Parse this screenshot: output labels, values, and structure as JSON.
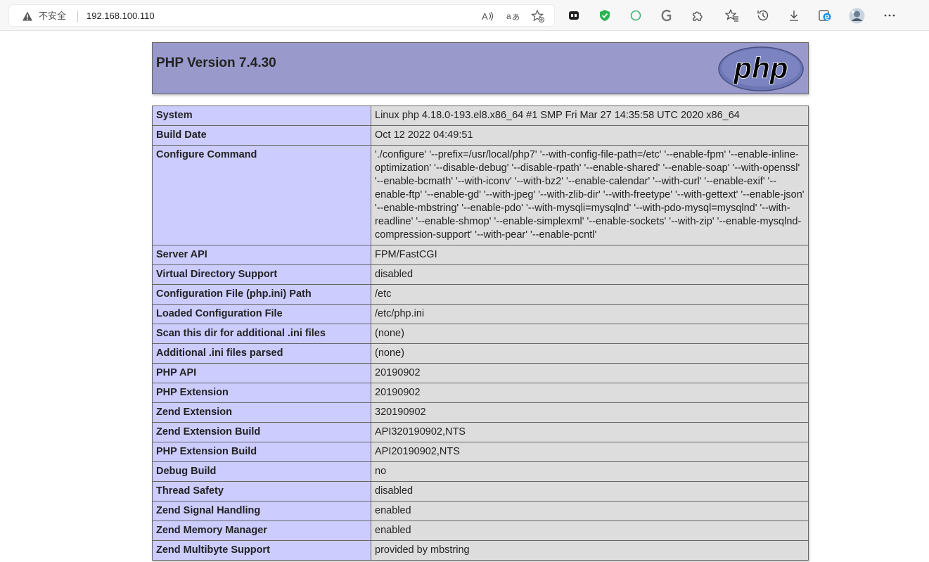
{
  "browser": {
    "security_warning": "不安全",
    "url": "192.168.100.110",
    "icons": {
      "warning": "warning-triangle-icon",
      "read_aloud": "read-aloud-icon",
      "translate": "translate-icon",
      "favorite_add": "add-favorite-icon",
      "ext1": "extension-tile-icon",
      "ext2": "shield-check-icon",
      "ext3": "circle-icon",
      "ext4": "g-extension-icon",
      "extensions": "puzzle-icon",
      "favorites": "favorites-icon",
      "history": "history-icon",
      "downloads": "download-icon",
      "edge": "edge-icon",
      "profile": "avatar",
      "menu": "more-icon"
    }
  },
  "php": {
    "version_title": "PHP Version 7.4.30",
    "logo_text": "php",
    "rows": [
      {
        "label": "System",
        "value": "Linux php 4.18.0-193.el8.x86_64 #1 SMP Fri Mar 27 14:35:58 UTC 2020 x86_64"
      },
      {
        "label": "Build Date",
        "value": "Oct 12 2022 04:49:51"
      },
      {
        "label": "Configure Command",
        "value": "'./configure' '--prefix=/usr/local/php7' '--with-config-file-path=/etc' '--enable-fpm' '--enable-inline-optimization' '--disable-debug' '--disable-rpath' '--enable-shared' '--enable-soap' '--with-openssl' '--enable-bcmath' '--with-iconv' '--with-bz2' '--enable-calendar' '--with-curl' '--enable-exif' '--enable-ftp' '--enable-gd' '--with-jpeg' '--with-zlib-dir' '--with-freetype' '--with-gettext' '--enable-json' '--enable-mbstring' '--enable-pdo' '--with-mysqli=mysqlnd' '--with-pdo-mysql=mysqlnd' '--with-readline' '--enable-shmop' '--enable-simplexml' '--enable-sockets' '--with-zip' '--enable-mysqlnd-compression-support' '--with-pear' '--enable-pcntl'"
      },
      {
        "label": "Server API",
        "value": "FPM/FastCGI"
      },
      {
        "label": "Virtual Directory Support",
        "value": "disabled"
      },
      {
        "label": "Configuration File (php.ini) Path",
        "value": "/etc"
      },
      {
        "label": "Loaded Configuration File",
        "value": "/etc/php.ini"
      },
      {
        "label": "Scan this dir for additional .ini files",
        "value": "(none)"
      },
      {
        "label": "Additional .ini files parsed",
        "value": "(none)"
      },
      {
        "label": "PHP API",
        "value": "20190902"
      },
      {
        "label": "PHP Extension",
        "value": "20190902"
      },
      {
        "label": "Zend Extension",
        "value": "320190902"
      },
      {
        "label": "Zend Extension Build",
        "value": "API320190902,NTS"
      },
      {
        "label": "PHP Extension Build",
        "value": "API20190902,NTS"
      },
      {
        "label": "Debug Build",
        "value": "no"
      },
      {
        "label": "Thread Safety",
        "value": "disabled"
      },
      {
        "label": "Zend Signal Handling",
        "value": "enabled"
      },
      {
        "label": "Zend Memory Manager",
        "value": "enabled"
      },
      {
        "label": "Zend Multibyte Support",
        "value": "provided by mbstring"
      }
    ]
  }
}
